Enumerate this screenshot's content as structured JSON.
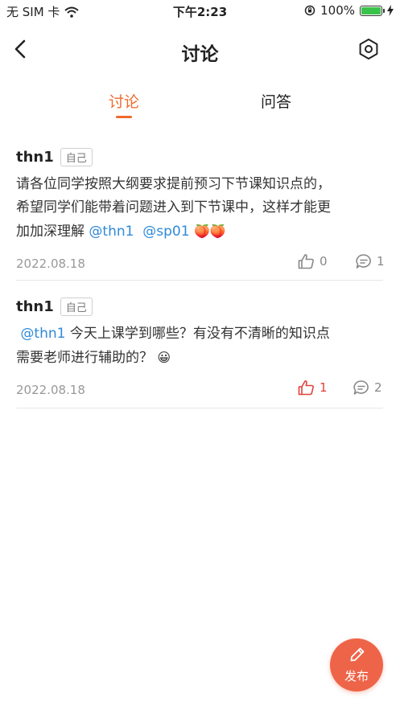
{
  "status_bar": {
    "carrier": "无 SIM 卡",
    "time": "下午2:23",
    "battery": "100%"
  },
  "nav": {
    "title": "讨论"
  },
  "tabs": [
    {
      "label": "讨论",
      "active": true
    },
    {
      "label": "问答",
      "active": false
    }
  ],
  "posts": [
    {
      "author": "thn1",
      "badge": "自己",
      "text_line1": "请各位同学按照大纲要求提前预习下节课知识点的，",
      "text_line2": "希望同学们能带着问题进入到下节课中，这样才能更",
      "text_line3_prefix": "加加深理解 ",
      "mention1": "@thn1",
      "mention2": "@sp01",
      "emoji": "🍑🍑",
      "date": "2022.08.18",
      "likes": "0",
      "comments": "1",
      "liked": false
    },
    {
      "author": "thn1",
      "badge": "自己",
      "mention": "@thn1",
      "text_line1": " 今天上课学到哪些？有没有不清晰的知识点",
      "text_line2": "需要老师进行辅助的？",
      "emoji": "😀",
      "date": "2022.08.18",
      "likes": "1",
      "comments": "2",
      "liked": true
    }
  ],
  "fab": {
    "label": "发布"
  },
  "colors": {
    "accent": "#ef6a2c",
    "mention": "#2f8ad8",
    "like_active": "#e0413a",
    "fab_bg": "#ee6448"
  }
}
